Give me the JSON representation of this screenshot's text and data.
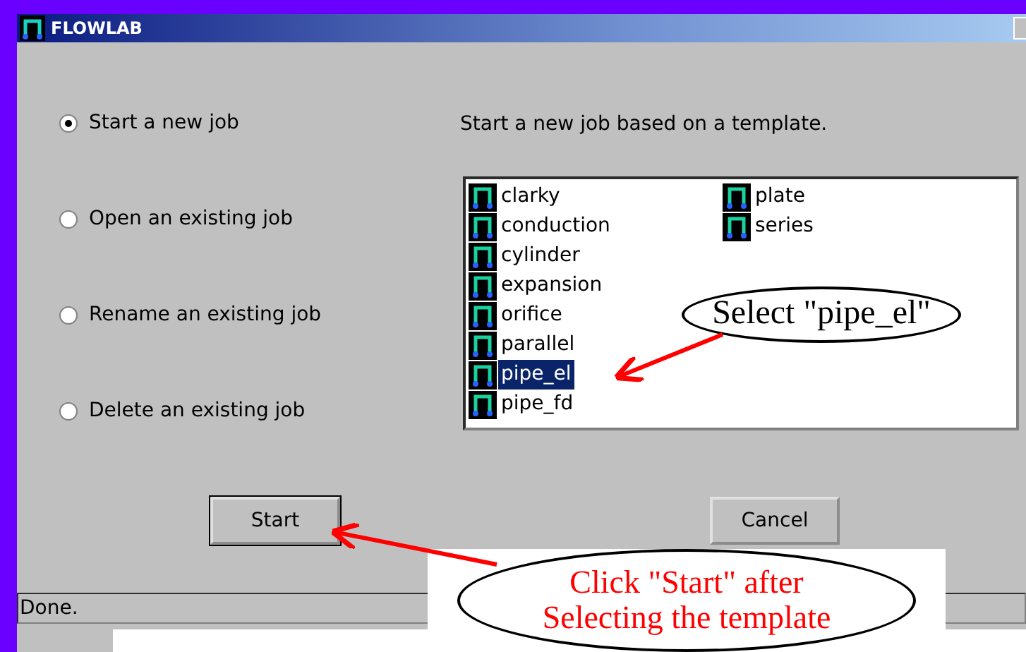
{
  "window": {
    "title": "FLOWLAB"
  },
  "options": [
    {
      "label": "Start a new job",
      "selected": true
    },
    {
      "label": "Open an existing job",
      "selected": false
    },
    {
      "label": "Rename an existing job",
      "selected": false
    },
    {
      "label": "Delete an existing job",
      "selected": false
    }
  ],
  "description": "Start a new job based on a template.",
  "templates": [
    {
      "name": "clarky",
      "selected": false
    },
    {
      "name": "conduction",
      "selected": false
    },
    {
      "name": "cylinder",
      "selected": false
    },
    {
      "name": "expansion",
      "selected": false
    },
    {
      "name": "orifice",
      "selected": false
    },
    {
      "name": "parallel",
      "selected": false
    },
    {
      "name": "pipe_el",
      "selected": true
    },
    {
      "name": "pipe_fd",
      "selected": false
    },
    {
      "name": "plate",
      "selected": false
    },
    {
      "name": "series",
      "selected": false
    }
  ],
  "buttons": [
    "Start",
    "Cancel"
  ],
  "status_bar": "Done.",
  "callouts": [
    {
      "lines": [
        "Select \"pipe_el\""
      ]
    },
    {
      "lines": [
        "Click \"Start\" after",
        "Selecting the template"
      ]
    }
  ]
}
